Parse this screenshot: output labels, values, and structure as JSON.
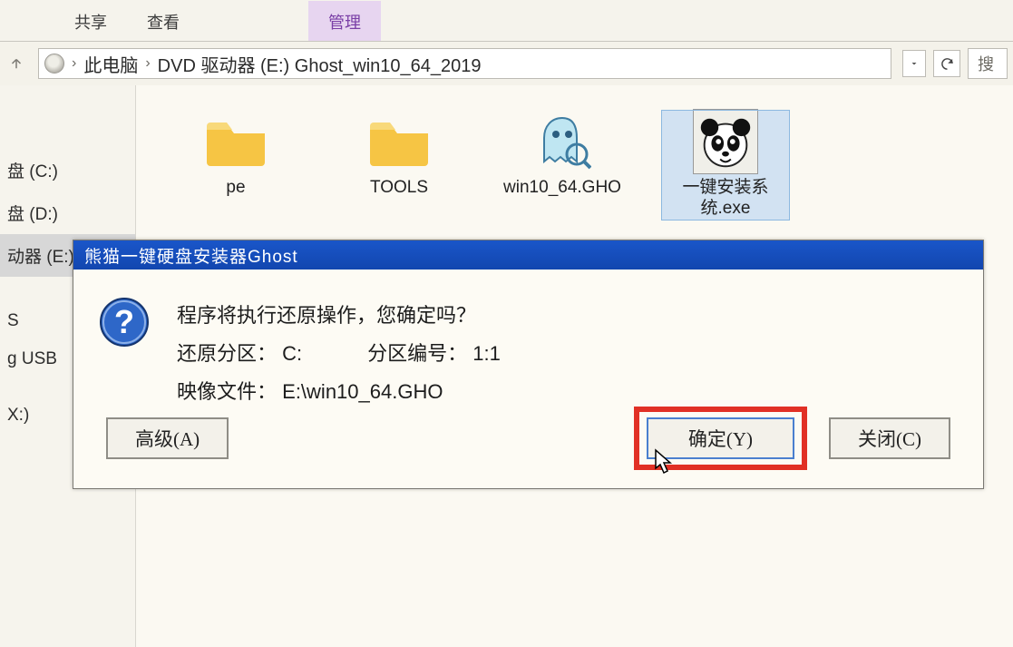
{
  "ribbon": {
    "share": "共享",
    "view": "查看",
    "manage": "管理"
  },
  "breadcrumb": {
    "pc": "此电脑",
    "drive": "DVD 驱动器 (E:) Ghost_win10_64_2019",
    "search_placeholder": "搜"
  },
  "sidebar": {
    "c": "盘 (C:)",
    "d": "盘 (D:)",
    "dvd": "动器 (E:) Gh",
    "s_label": "S",
    "usb": "g USB",
    "x": "X:)"
  },
  "files": {
    "pe": "pe",
    "tools": "TOOLS",
    "gho": "win10_64.GHO",
    "installer": "一键安装系统.exe"
  },
  "dialog": {
    "title": "熊猫一键硬盘安装器Ghost",
    "line1": "程序将执行还原操作，您确定吗？",
    "restore_part_label": "还原分区：",
    "restore_part_value": "C:",
    "part_num_label": "分区编号：",
    "part_num_value": "1:1",
    "image_label": "映像文件：",
    "image_value": "E:\\win10_64.GHO",
    "btn_adv": "高级(A)",
    "btn_ok": "确定(Y)",
    "btn_close": "关闭(C)"
  }
}
